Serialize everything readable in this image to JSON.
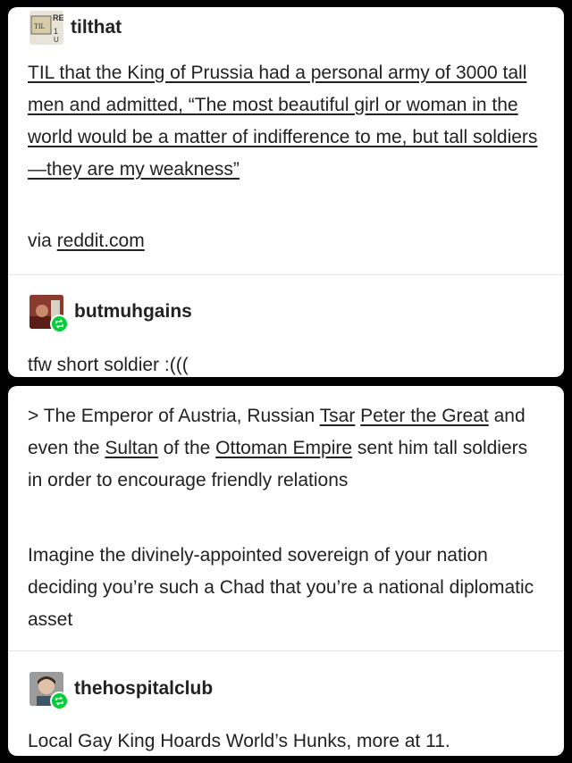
{
  "post1": {
    "username": "tilthat",
    "text": "TIL that the King of Prussia had a personal army of 3000 tall men and admitted, “The most beautiful girl or woman in the world would be a matter of indifference to me, but tall soldiers—they are my weakness”",
    "via_prefix": "via ",
    "via_link": "reddit.com"
  },
  "reply1": {
    "username": "butmuhgains",
    "text": "tfw short soldier :((("
  },
  "post2": {
    "quote_prefix": "> The Emperor of Austria, Russian ",
    "link_tsar": "Tsar",
    "link_peter": "Peter the Great",
    "middle1": " and even the ",
    "link_sultan": "Sultan",
    "middle2": " of the ",
    "link_ottoman": "Ottoman Empire",
    "quote_suffix": " sent him tall soldiers in order to encourage friendly relations",
    "comment": "Imagine the divinely-appointed sovereign of your nation deciding you’re such a Chad that you’re a national diplomatic asset"
  },
  "reply2": {
    "username": "thehospitalclub",
    "text": "Local Gay King Hoards World’s Hunks, more at 11."
  },
  "colors": {
    "reblog_badge": "#00cf35",
    "background": "#000000",
    "card": "#ffffff"
  },
  "icons": {
    "reblog": "reblog-icon"
  }
}
